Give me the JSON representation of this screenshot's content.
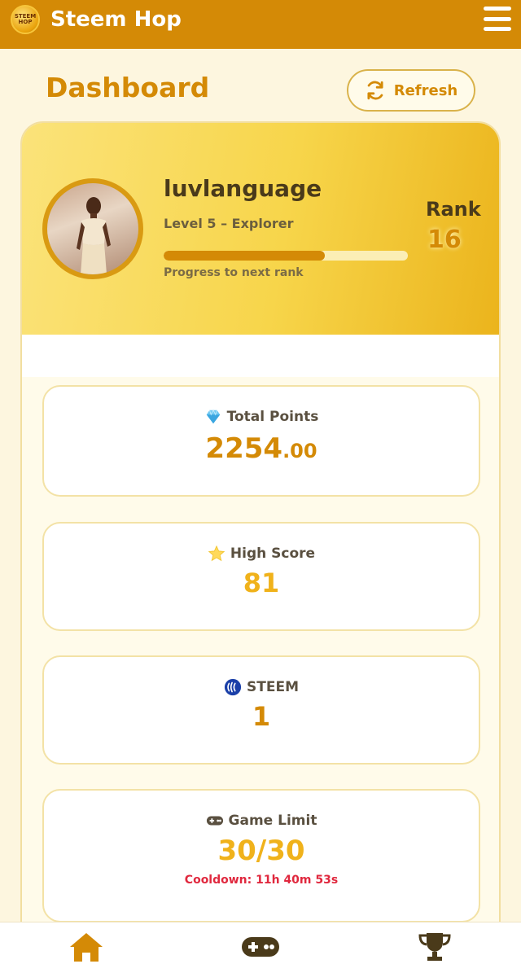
{
  "app": {
    "title": "Steem Hop",
    "logo_text": "STEEM HOP"
  },
  "page": {
    "title": "Dashboard",
    "refresh_label": "Refresh"
  },
  "profile": {
    "username": "luvlanguage",
    "level": "Level 5 – Explorer",
    "progress": 0.66,
    "progress_label": "Progress to next rank",
    "rank_label": "Rank",
    "rank_value": "16"
  },
  "stats": {
    "total_points": {
      "label": "Total Points",
      "value_int": "2254",
      "value_dec": ".00",
      "icon": "diamond-icon"
    },
    "high_score": {
      "label": "High Score",
      "value": "81",
      "icon": "star-icon"
    },
    "steem": {
      "label": "STEEM",
      "value": "1",
      "icon": "steem-icon"
    },
    "game_limit": {
      "label": "Game Limit",
      "value": "30/30",
      "cooldown": "Cooldown: 11h 40m 53s",
      "icon": "gamepad-icon"
    }
  },
  "nav": {
    "items": [
      "home-icon",
      "gamepad-icon",
      "trophy-icon"
    ],
    "active": "home-icon"
  },
  "colors": {
    "primary": "#d48a06",
    "gold": "#f0b21b",
    "danger": "#e0283e",
    "background": "#fdf6df"
  }
}
